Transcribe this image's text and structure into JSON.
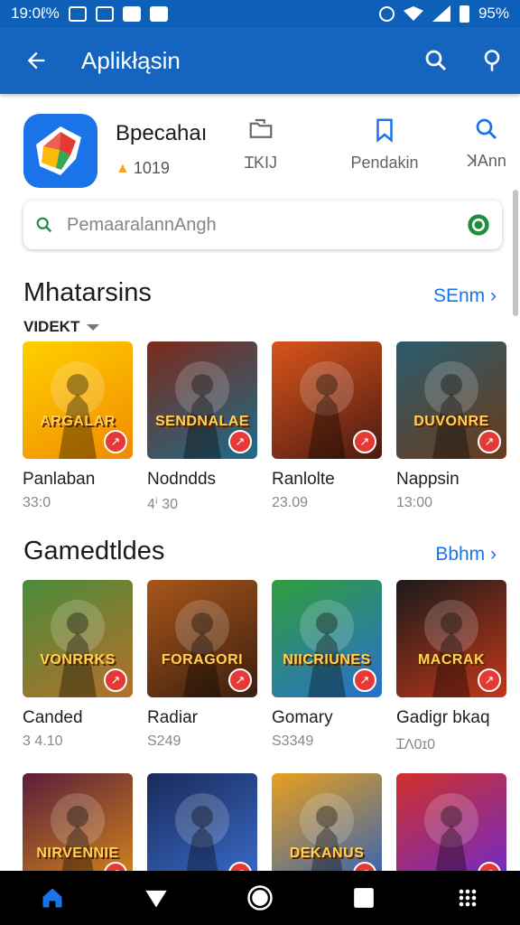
{
  "status_bar": {
    "time": "19:0ℓ%",
    "battery": "95%"
  },
  "app_bar": {
    "title": "Aplikłąsin"
  },
  "app_header": {
    "name": "Bpecahaı",
    "rating": "1019",
    "actions": [
      {
        "label": "ꞮKIJ",
        "icon": "folder-icon"
      },
      {
        "label": "Pendakin",
        "icon": "bookmark-icon"
      },
      {
        "label": "ꓘAnn",
        "icon": "search-icon"
      }
    ]
  },
  "search": {
    "placeholder": "PemaaralannAngh"
  },
  "sections": [
    {
      "title": "Mhatarsins",
      "see_more": "SEnm",
      "filter": "VIDEKT",
      "cards": [
        {
          "name": "Panlaban",
          "sub": "33:0",
          "art_title": "ARGALAR",
          "colors": [
            "#ffd000",
            "#f08a00"
          ]
        },
        {
          "name": "Nodndds",
          "sub": "4ⁱ 30",
          "art_title": "SENDNALAE",
          "colors": [
            "#7b2a1a",
            "#1f6b8a"
          ]
        },
        {
          "name": "Ranlolte",
          "sub": "23.09",
          "art_title": "",
          "colors": [
            "#d9541a",
            "#4a1a12"
          ]
        },
        {
          "name": "Nappsin",
          "sub": "13:00",
          "art_title": "DUVONRE",
          "colors": [
            "#2a5c6e",
            "#6b3a1a"
          ]
        }
      ]
    },
    {
      "title": "Gamedtldes",
      "see_more": "Bbhm",
      "cards": [
        {
          "name": "Canded",
          "sub": "3 4.10",
          "art_title": "VONRRKS",
          "colors": [
            "#4a8c3a",
            "#b5702a"
          ]
        },
        {
          "name": "Radiar",
          "sub": "S249",
          "art_title": "FORAGORI",
          "colors": [
            "#a8561a",
            "#3a1e10"
          ]
        },
        {
          "name": "Gomary",
          "sub": "S3349",
          "art_title": "NIICRIUNES",
          "colors": [
            "#2f9e3a",
            "#2a6fd0"
          ]
        },
        {
          "name": "Gadigr bkaq",
          "sub": "ꞮΛ0ɪ0",
          "art_title": "MACRAK",
          "colors": [
            "#1a1a1a",
            "#c2371a"
          ]
        }
      ]
    },
    {
      "title": "",
      "cards": [
        {
          "name": "",
          "sub": "",
          "art_title": "NIRVENNIE",
          "colors": [
            "#5a1e3a",
            "#d98a1a"
          ]
        },
        {
          "name": "",
          "sub": "",
          "art_title": "",
          "colors": [
            "#1a2a5a",
            "#3a6fd0"
          ]
        },
        {
          "name": "",
          "sub": "",
          "art_title": "DEKANUS",
          "colors": [
            "#e8a01a",
            "#2a5fc0"
          ]
        },
        {
          "name": "",
          "sub": "",
          "art_title": "",
          "colors": [
            "#d0302a",
            "#6a2ad0"
          ]
        }
      ]
    }
  ]
}
